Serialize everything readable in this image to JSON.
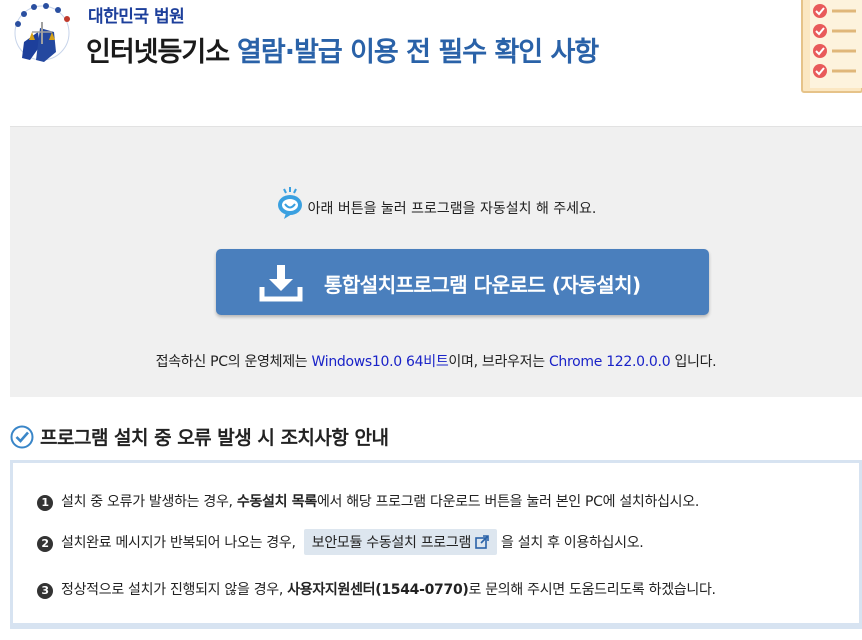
{
  "header": {
    "court_name": "대한민국 법원",
    "title_part1": "인터넷등기소",
    "title_part2": "열람·발급 이용 전 필수 확인 사항"
  },
  "install": {
    "hint": "아래 버튼을 눌러 프로그램을 자동설치 해 주세요.",
    "download_button": "통합설치프로그램 다운로드 (자동설치)",
    "env_prefix": "접속하신 PC의 운영체제는 ",
    "os": "Windows10.0 64비트",
    "env_middle": "이며, 브라우저는 ",
    "browser": "Chrome 122.0.0.0",
    "env_suffix": " 입니다."
  },
  "section": {
    "title": "프로그램 설치 중 오류 발생 시 조치사항 안내"
  },
  "guide": {
    "item1": {
      "num": "1",
      "pre": "설치 중 오류가 발생하는 경우, ",
      "bold": "수동설치 목록",
      "post": "에서 해당 프로그램 다운로드 버튼을 눌러 본인 PC에 설치하십시오."
    },
    "item2": {
      "num": "2",
      "pre": "설치완료 메시지가 반복되어 나오는 경우, ",
      "button": "보안모듈 수동설치 프로그램",
      "post": "을 설치 후 이용하십시오."
    },
    "item3": {
      "num": "3",
      "pre": "정상적으로 설치가 진행되지 않을 경우, ",
      "bold": "사용자지원센터(1544-0770)",
      "post": "로 문의해 주시면 도움드리도록 하겠습니다."
    }
  },
  "colors": {
    "accent": "#4a7fbd",
    "highlight": "#1a23c8",
    "court_blue": "#1d3f9b"
  }
}
